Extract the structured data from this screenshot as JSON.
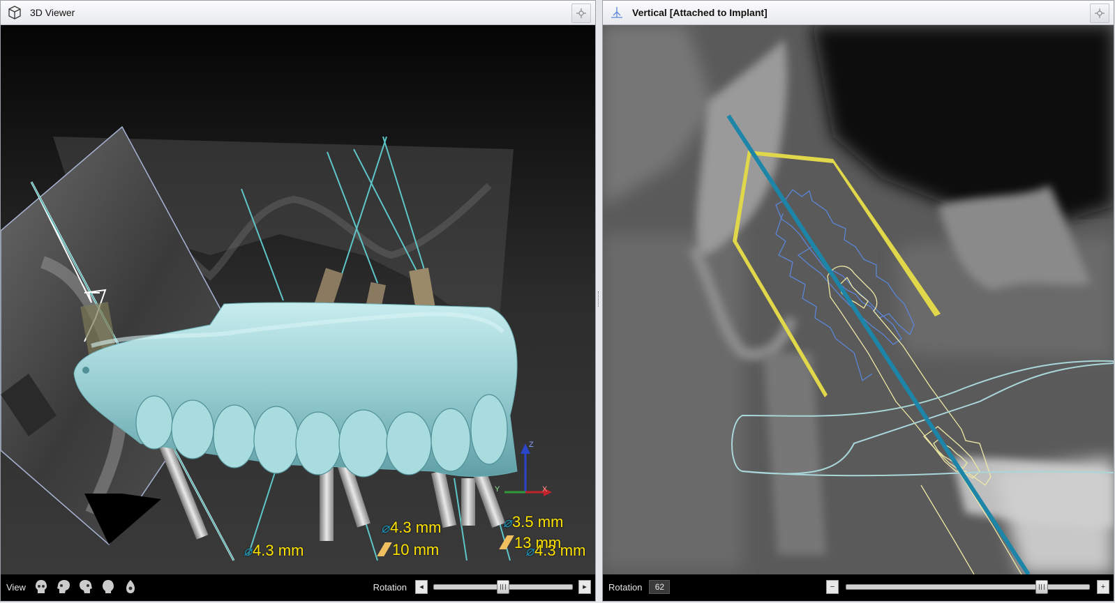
{
  "left_panel": {
    "title": "3D Viewer",
    "icons": {
      "title_icon": "cube-icon",
      "pin": "pin-icon"
    },
    "measurements": [
      {
        "diameter": "4.3 mm"
      },
      {
        "diameter": "4.3 mm",
        "length": "10 mm"
      },
      {
        "diameter": "3.5 mm",
        "length": "13 mm"
      },
      {
        "diameter": "4.3 mm"
      }
    ],
    "axes": {
      "z": "Z",
      "x": "X",
      "y": "Y"
    },
    "bottom": {
      "view_label": "View",
      "view_icons": [
        "skull-front-icon",
        "skull-left-icon",
        "skull-right-icon",
        "skull-back-icon",
        "skull-top-icon"
      ],
      "rotation_label": "Rotation",
      "slider_fraction": 0.5
    }
  },
  "right_panel": {
    "title": "Vertical [Attached to Implant]",
    "icons": {
      "title_icon": "vertical-plane-icon",
      "pin": "pin-icon"
    },
    "bottom": {
      "rotation_label": "Rotation",
      "rotation_value": "62",
      "minus": "−",
      "plus": "+",
      "slider_fraction": 0.82
    }
  },
  "colors": {
    "implant_axis": "#1d86a8",
    "safety_zone": "#e0d84a",
    "implant_outline": "#5b86d8",
    "guide_outline": "#a9d7d9",
    "measurement_text": "#ffe400",
    "denture": "#9fd3d6"
  }
}
